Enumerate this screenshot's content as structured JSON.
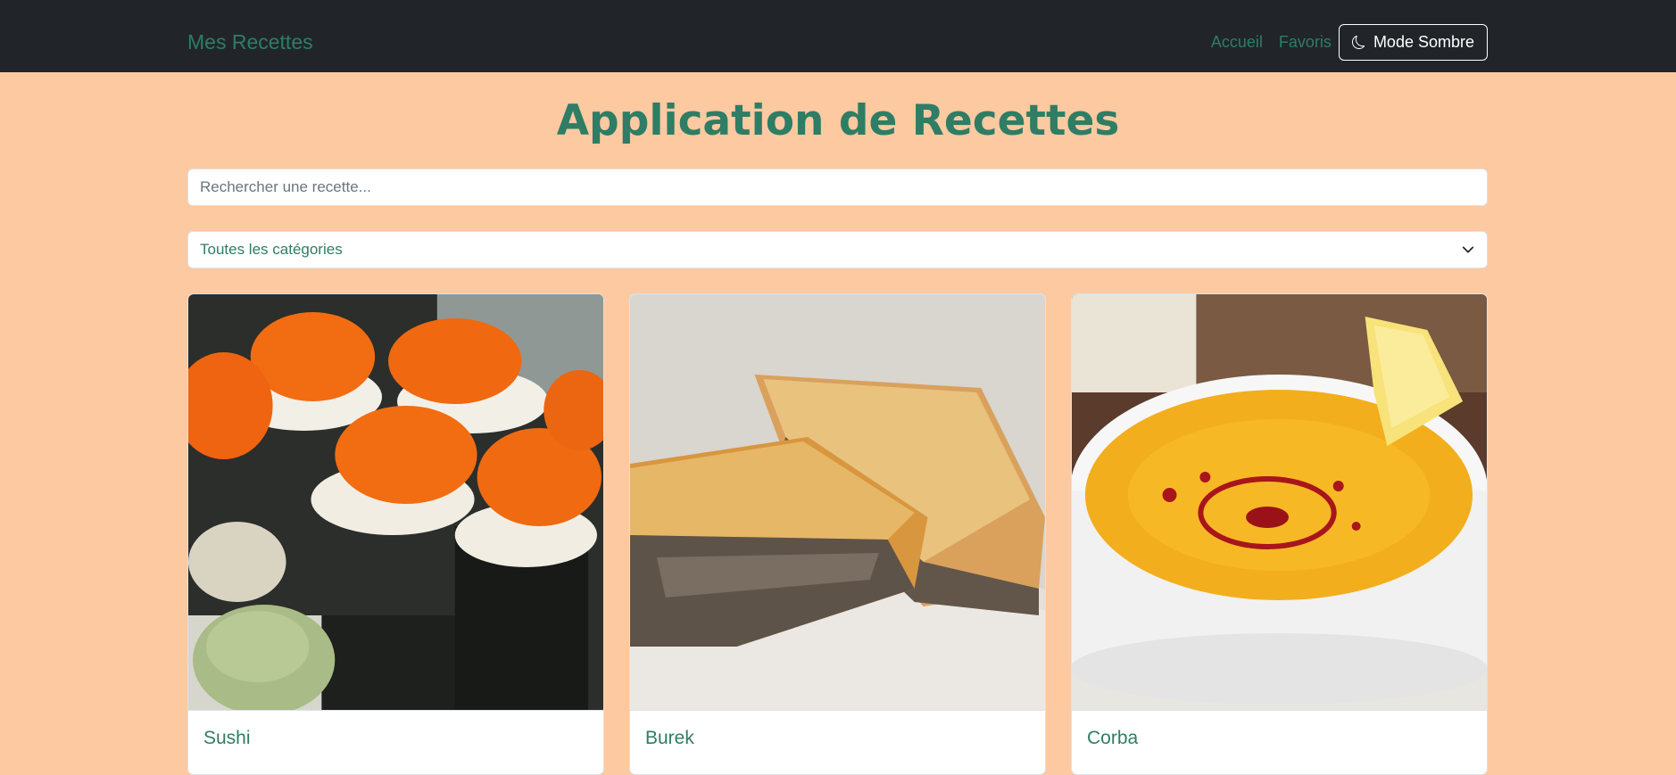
{
  "navbar": {
    "brand": "Mes Recettes",
    "links": [
      "Accueil",
      "Favoris"
    ],
    "dark_mode_label": "Mode Sombre"
  },
  "main": {
    "title": "Application de Recettes",
    "search_placeholder": "Rechercher une recette...",
    "category_selected": "Toutes les catégories"
  },
  "recipes": [
    {
      "name": "Sushi"
    },
    {
      "name": "Burek"
    },
    {
      "name": "Corba"
    }
  ],
  "colors": {
    "accent": "#2e7d64",
    "navbar": "#212529",
    "background": "#fdc9a1"
  }
}
